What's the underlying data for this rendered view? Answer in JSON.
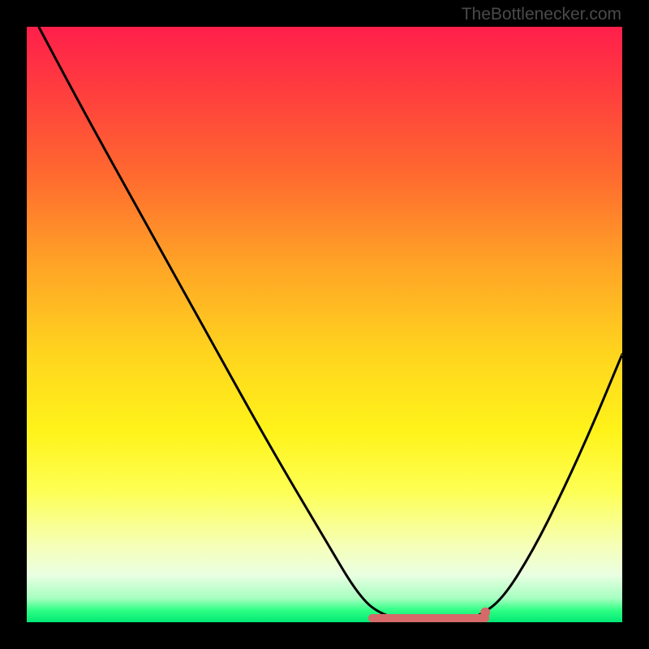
{
  "credit_text": "TheBottlenecker.com",
  "colors": {
    "background": "#000000",
    "curve_stroke": "#000000",
    "sweet_spot_stroke": "#d66a6a",
    "sweet_spot_dot_fill": "#d66a6a",
    "gradient_top": "#ff1f4b",
    "gradient_bottom": "#00e874"
  },
  "chart_data": {
    "type": "line",
    "title": "",
    "xlabel": "",
    "ylabel": "",
    "xlim": [
      0,
      100
    ],
    "ylim": [
      0,
      100
    ],
    "curve_points": [
      {
        "x": 2,
        "y": 100
      },
      {
        "x": 10,
        "y": 85
      },
      {
        "x": 20,
        "y": 67
      },
      {
        "x": 30,
        "y": 49
      },
      {
        "x": 40,
        "y": 31
      },
      {
        "x": 50,
        "y": 14
      },
      {
        "x": 56,
        "y": 4
      },
      {
        "x": 60,
        "y": 1
      },
      {
        "x": 66,
        "y": 0
      },
      {
        "x": 72,
        "y": 0
      },
      {
        "x": 76,
        "y": 1
      },
      {
        "x": 80,
        "y": 4
      },
      {
        "x": 85,
        "y": 12
      },
      {
        "x": 90,
        "y": 22
      },
      {
        "x": 95,
        "y": 33
      },
      {
        "x": 100,
        "y": 45
      }
    ],
    "sweet_spot": {
      "x_start": 58,
      "x_end": 77,
      "y": 0
    },
    "sweet_spot_dot": {
      "x": 77,
      "y": 1
    }
  }
}
